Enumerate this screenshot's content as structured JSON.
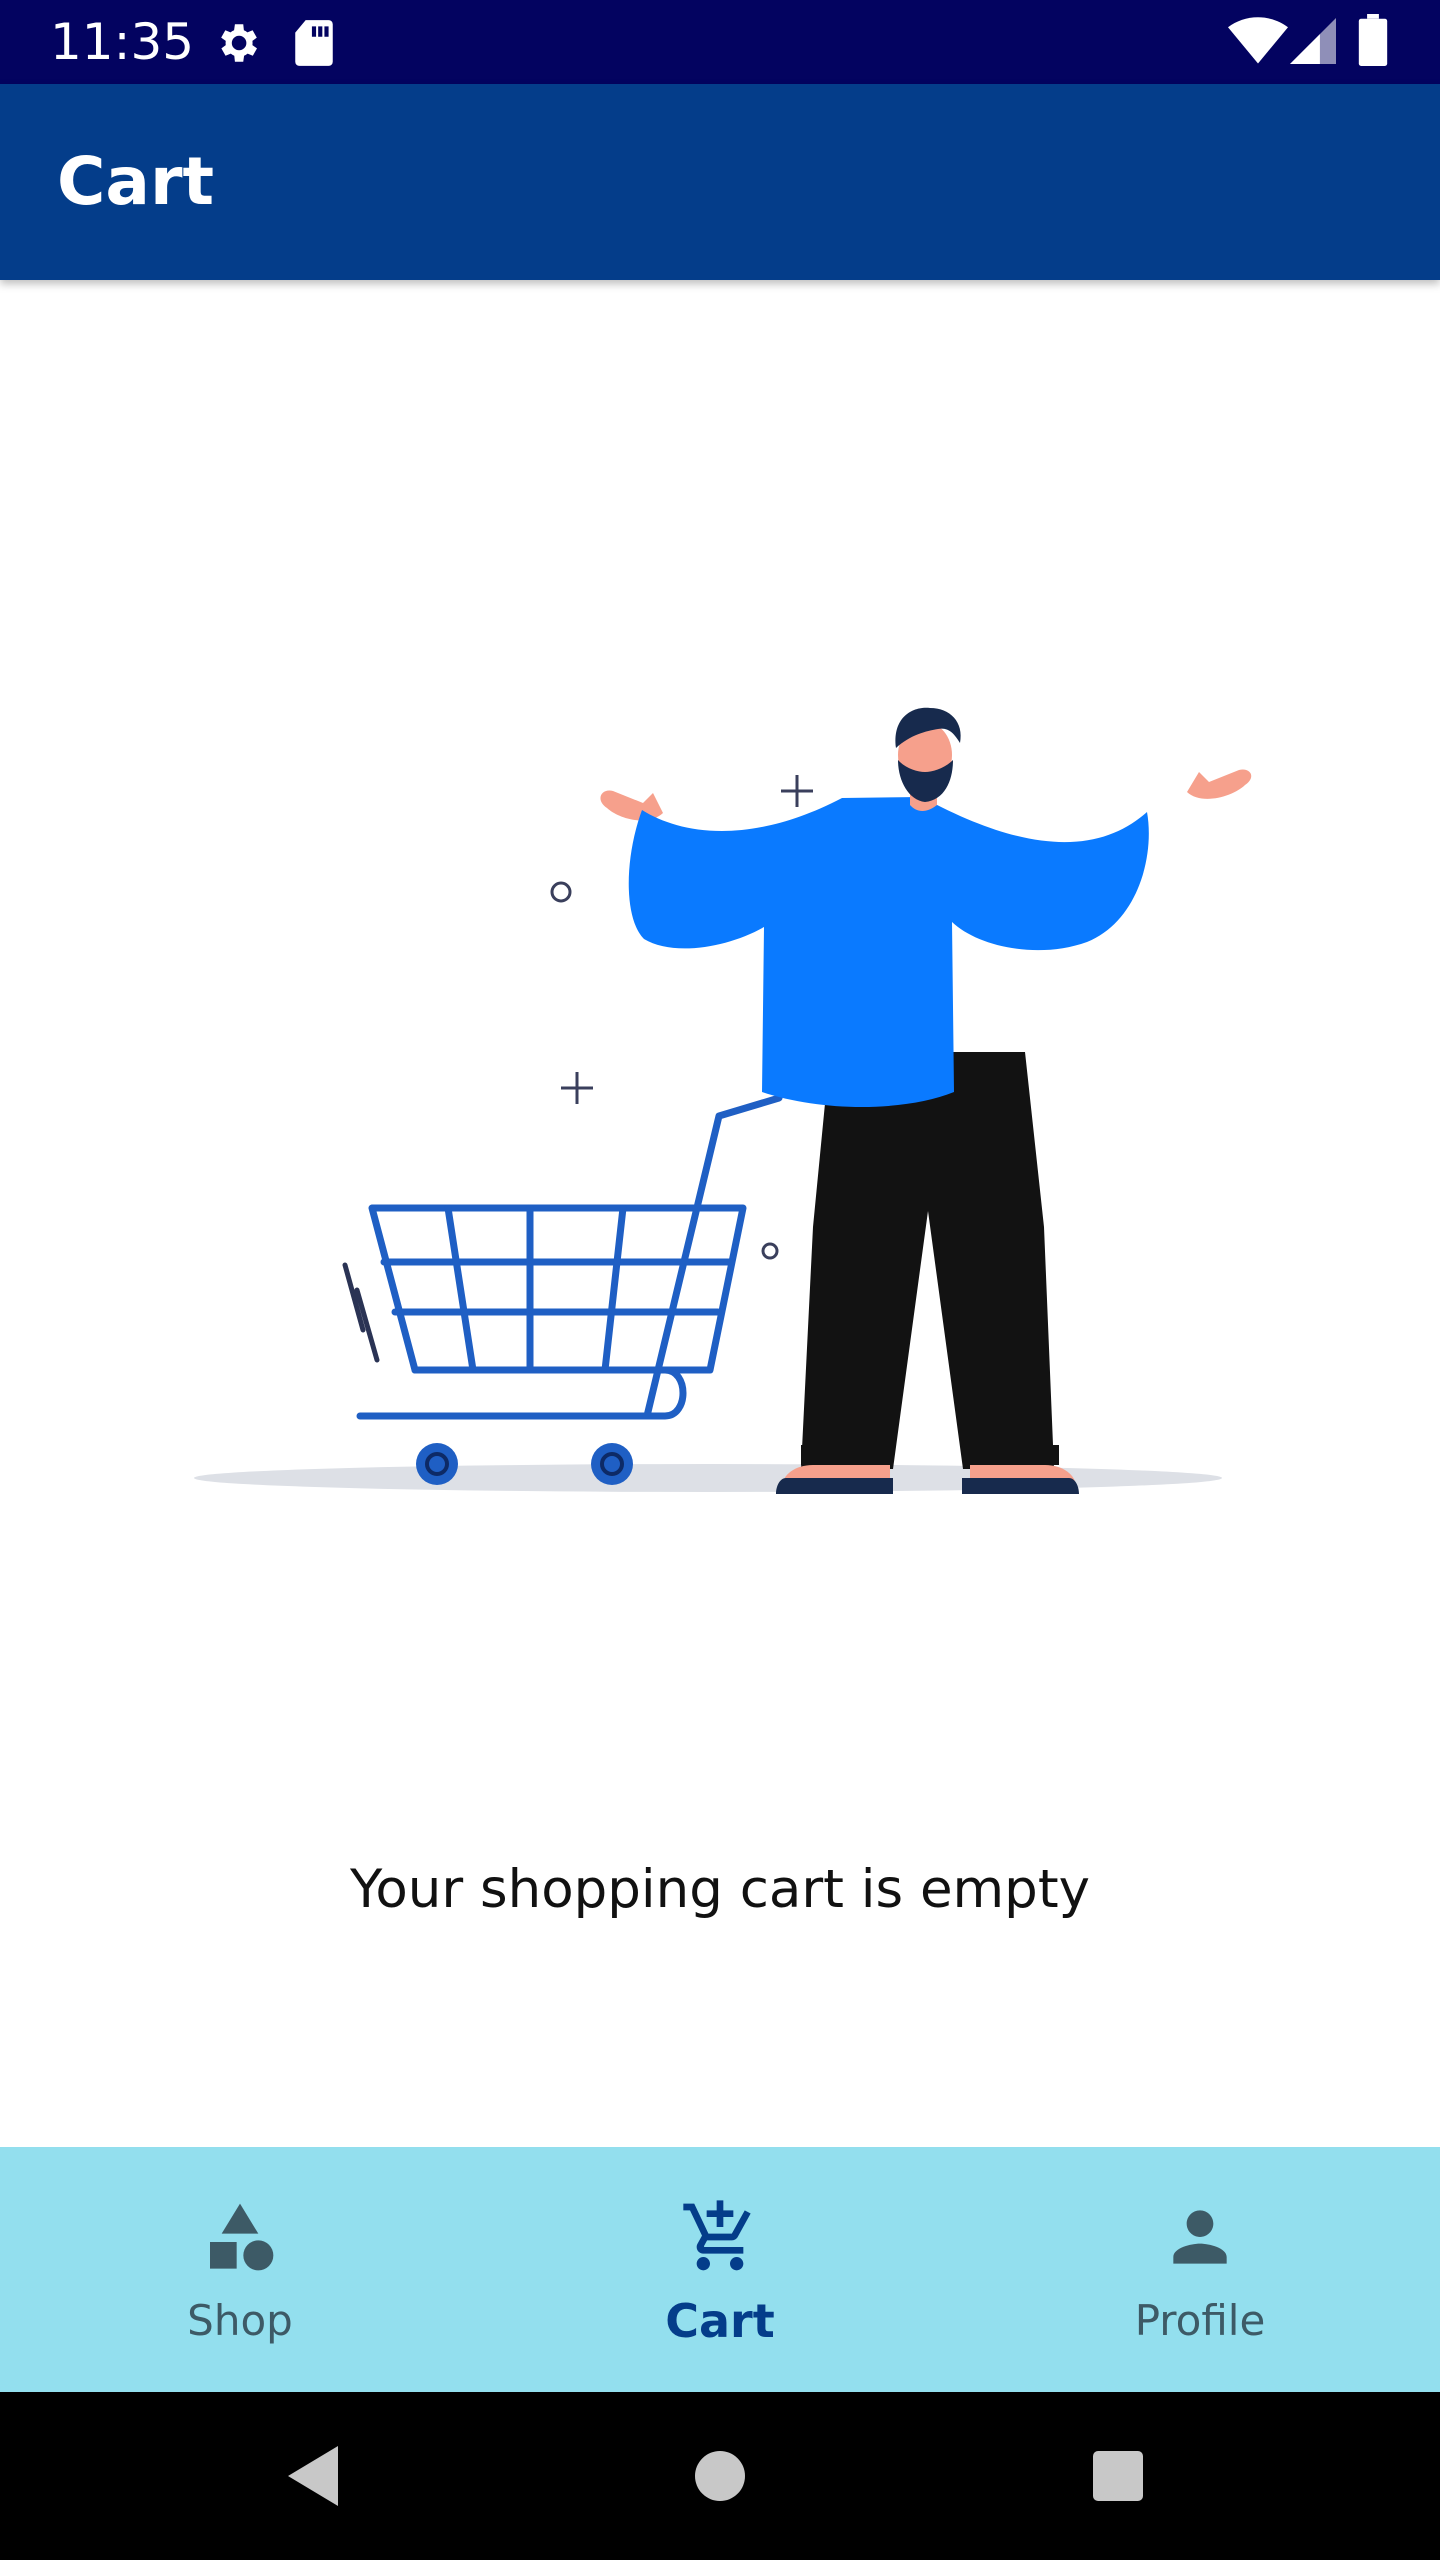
{
  "status_bar": {
    "time": "11:35",
    "icons": [
      "gear-icon",
      "sd-card-icon",
      "wifi-icon",
      "signal-icon",
      "battery-icon"
    ]
  },
  "app_bar": {
    "title": "Cart"
  },
  "main": {
    "illustration": "empty-cart-illustration",
    "empty_message": "Your shopping cart is empty"
  },
  "bottom_nav": {
    "items": [
      {
        "label": "Shop",
        "icon": "shapes-icon",
        "active": false
      },
      {
        "label": "Cart",
        "icon": "add-to-cart-icon",
        "active": true
      },
      {
        "label": "Profile",
        "icon": "person-icon",
        "active": false
      }
    ]
  },
  "system_nav": {
    "buttons": [
      "back-icon",
      "home-icon",
      "recents-icon"
    ]
  },
  "colors": {
    "status_bar": "#030360",
    "app_bar": "#043d8a",
    "bottom_nav": "#93dfee",
    "active_tab": "#043d8a",
    "inactive_tab": "#3d5a66"
  }
}
